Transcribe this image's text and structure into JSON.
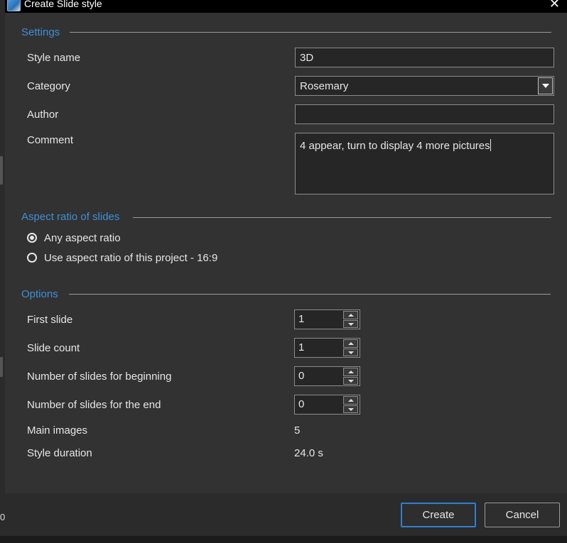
{
  "window": {
    "title": "Create Slide style",
    "close_glyph": "✕"
  },
  "background": {
    "edge_digit": "0"
  },
  "settings": {
    "heading": "Settings",
    "style_name_label": "Style name",
    "style_name_value": "3D",
    "category_label": "Category",
    "category_value": "Rosemary",
    "author_label": "Author",
    "author_value": "",
    "comment_label": "Comment",
    "comment_value": "4 appear, turn to display 4 more pictures"
  },
  "aspect": {
    "heading": "Aspect ratio of slides",
    "options": [
      {
        "label": "Any aspect ratio",
        "checked": true
      },
      {
        "label": "Use aspect ratio of this project - 16:9",
        "checked": false
      }
    ]
  },
  "options": {
    "heading": "Options",
    "first_slide_label": "First slide",
    "first_slide_value": "1",
    "slide_count_label": "Slide count",
    "slide_count_value": "1",
    "beginning_label": "Number of slides for beginning",
    "beginning_value": "0",
    "end_label": "Number of slides for the end",
    "end_value": "0",
    "main_images_label": "Main images",
    "main_images_value": "5",
    "duration_label": "Style duration",
    "duration_value": "24.0 s"
  },
  "footer": {
    "create_label": "Create",
    "cancel_label": "Cancel"
  },
  "colors": {
    "accent": "#3f8fd6",
    "dialog_bg": "#323232",
    "title_bg": "#000000"
  }
}
